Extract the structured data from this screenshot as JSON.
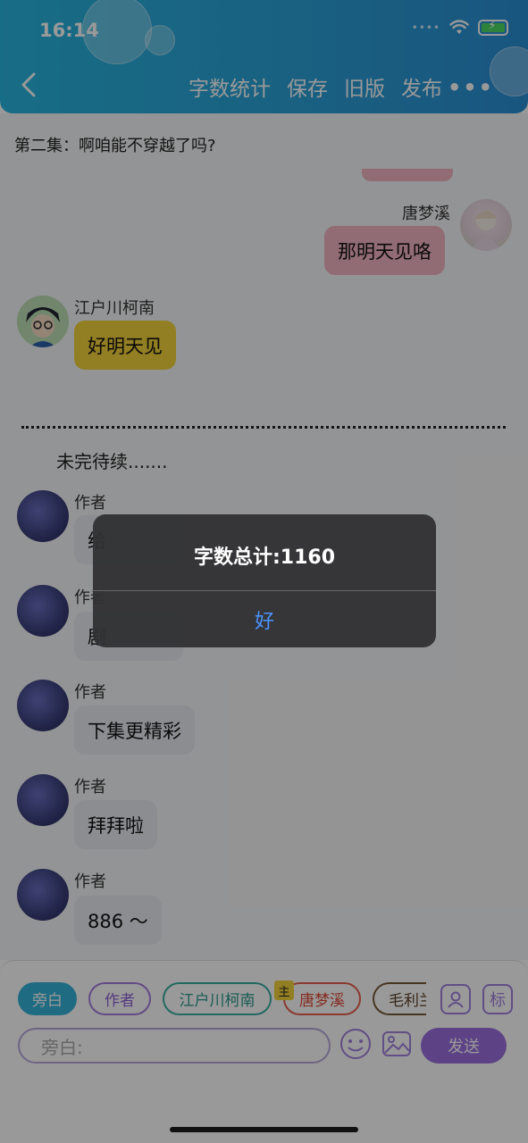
{
  "status_bar": {
    "time": "16:14",
    "signal": "••••"
  },
  "header": {
    "actions": [
      "字数统计",
      "保存",
      "旧版",
      "发布"
    ],
    "more": "•••"
  },
  "episode_title": "第二集：啊咱能不穿越了吗?",
  "messages": [
    {
      "speaker": "唐梦溪",
      "text": "那明天见咯",
      "side": "right"
    },
    {
      "speaker": "江户川柯南",
      "text": "好明天见",
      "side": "left"
    },
    {
      "speaker": "作者",
      "text": "给",
      "side": "left"
    },
    {
      "speaker": "作者",
      "text": "剧",
      "side": "left"
    },
    {
      "speaker": "作者",
      "text": "下集更精彩",
      "side": "left"
    },
    {
      "speaker": "作者",
      "text": "拜拜啦",
      "side": "left"
    },
    {
      "speaker": "作者",
      "text": "886 ～",
      "side": "left"
    }
  ],
  "to_be_continued": "未完待续.......",
  "composer": {
    "roles": [
      "旁白",
      "作者",
      "江户川柯南",
      "唐梦溪",
      "毛利兰"
    ],
    "main_badge": "主",
    "mark_button": "标",
    "input_placeholder": "旁白:",
    "send_label": "发送"
  },
  "alert": {
    "title": "字数总计:1160",
    "ok_label": "好"
  },
  "colors": {
    "header": "#2aa3d8",
    "pink_bubble": "#f2b4c1",
    "yellow_bubble": "#f3d33b",
    "gray_bubble": "#e8ebf0",
    "send": "#9b6fe0",
    "alert_link": "#4a95ff"
  }
}
